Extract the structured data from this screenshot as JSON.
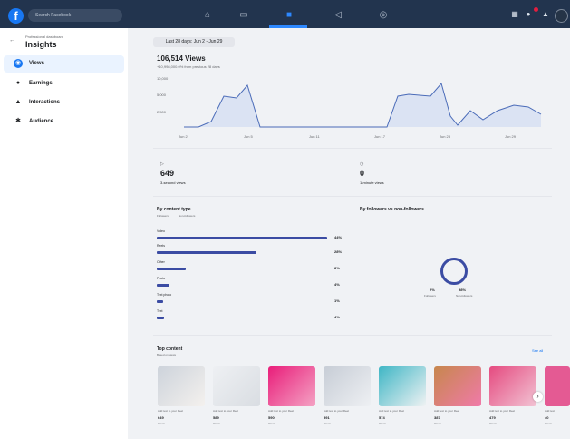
{
  "topbar": {
    "logo": "f",
    "search_placeholder": "Search Facebook"
  },
  "sidebar": {
    "breadcrumb": "Professional dashboard",
    "title": "Insights",
    "items": [
      {
        "label": "Views",
        "icon": "eye-icon"
      },
      {
        "label": "Earnings",
        "icon": "dollar-icon"
      },
      {
        "label": "Interactions",
        "icon": "thumbs-up-icon"
      },
      {
        "label": "Audience",
        "icon": "people-icon"
      }
    ]
  },
  "main": {
    "date_range": "Last 28 days: Jun 2 - Jun 29",
    "views_title": "106,514 Views",
    "views_sub": "+10,998,000.0% from previous 28 days",
    "y_ticks": [
      "10,000",
      "5,000",
      "2,500"
    ],
    "x_ticks": [
      "Jun 2",
      "Jun 5",
      "Jun 11",
      "Jun 17",
      "Jun 23",
      "Jun 29"
    ],
    "metric_1": {
      "value": "649",
      "label": "3-second views"
    },
    "metric_2": {
      "value": "0",
      "label": "1-minute views"
    },
    "content_type_title": "By content type",
    "content_type_legend": [
      "Followers",
      "Non-followers"
    ],
    "content_types": [
      {
        "label": "Video",
        "pct": "44%",
        "value": 0.98
      },
      {
        "label": "Reels",
        "pct": "28%",
        "value": 0.55
      },
      {
        "label": "Other",
        "pct": "8%",
        "value": 0.16
      },
      {
        "label": "Photo",
        "pct": "4%",
        "value": 0.08
      },
      {
        "label": "Text photo",
        "pct": "1%",
        "value": 0.03
      },
      {
        "label": "Text",
        "pct": "4%",
        "value": 0.04
      }
    ],
    "followers_title": "By followers vs non-followers",
    "followers_values": [
      "2%",
      "98%"
    ],
    "followers_legend": [
      "Followers",
      "Non-followers"
    ],
    "top_content_title": "Top content",
    "top_content_sub": "Based on views",
    "see_all": "See all",
    "top_content": [
      {
        "caption": "Add text to your Reel",
        "num": "649",
        "lbl": "Views"
      },
      {
        "caption": "Add text to your Reel",
        "num": "589",
        "lbl": "Views"
      },
      {
        "caption": "Add text to your Reel",
        "num": "590",
        "lbl": "Views"
      },
      {
        "caption": "Add text to your Reel",
        "num": "591",
        "lbl": "Views"
      },
      {
        "caption": "Add text to your Reel",
        "num": "574",
        "lbl": "Views"
      },
      {
        "caption": "Add text to your Reel",
        "num": "387",
        "lbl": "Views"
      },
      {
        "caption": "Add text to your Reel",
        "num": "479",
        "lbl": "Views"
      },
      {
        "caption": "Add text",
        "num": "40",
        "lbl": "Views"
      }
    ]
  },
  "colors": {
    "accent": "#1877f2",
    "bar": "#3b4ca3",
    "topbar": "#22344e"
  }
}
